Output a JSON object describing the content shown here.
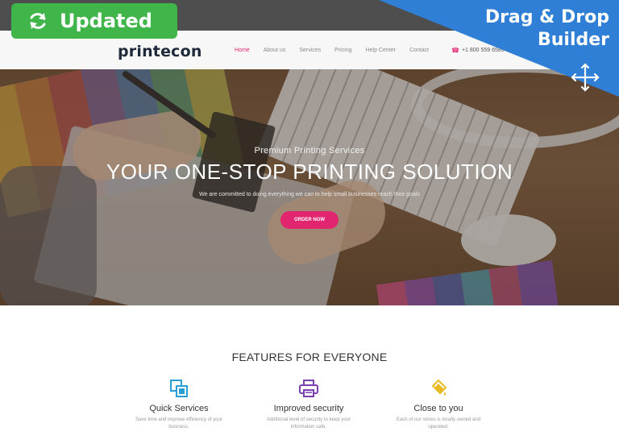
{
  "badge": {
    "label": "Updated",
    "icon": "refresh-icon",
    "color": "#3fb54a"
  },
  "ribbon": {
    "line1": "Drag & Drop",
    "line2": "Builder",
    "icon": "move-arrows-icon",
    "color": "#2f7fd6"
  },
  "brand": {
    "logo": "printecon"
  },
  "nav": {
    "items": [
      {
        "label": "Home",
        "active": true
      },
      {
        "label": "About us",
        "active": false
      },
      {
        "label": "Services",
        "active": false
      },
      {
        "label": "Pricing",
        "active": false
      },
      {
        "label": "Help Center",
        "active": false
      },
      {
        "label": "Contact",
        "active": false
      }
    ],
    "phone": "+1 800 559 6580",
    "accent": "#e2256f"
  },
  "hero": {
    "subtitle": "Premium Printing Services",
    "title": "YOUR ONE-STOP PRINTING SOLUTION",
    "description": "We are committed to doing everything we can to help small businesses reach their goals",
    "button": "ORDER NOW"
  },
  "features": {
    "title": "FEATURES FOR EVERYONE",
    "items": [
      {
        "name": "Quick Services",
        "desc": "Save time and improve efficiency of your business.",
        "icon": "copy-layers-icon",
        "color": "#2a9fd6"
      },
      {
        "name": "Improved security",
        "desc": "Additional level of security to keep your information safe.",
        "icon": "printer-icon",
        "color": "#7a3fb0"
      },
      {
        "name": "Close to you",
        "desc": "Each of our stores is locally owned and operated.",
        "icon": "paint-bucket-icon",
        "color": "#e8b923"
      }
    ]
  }
}
